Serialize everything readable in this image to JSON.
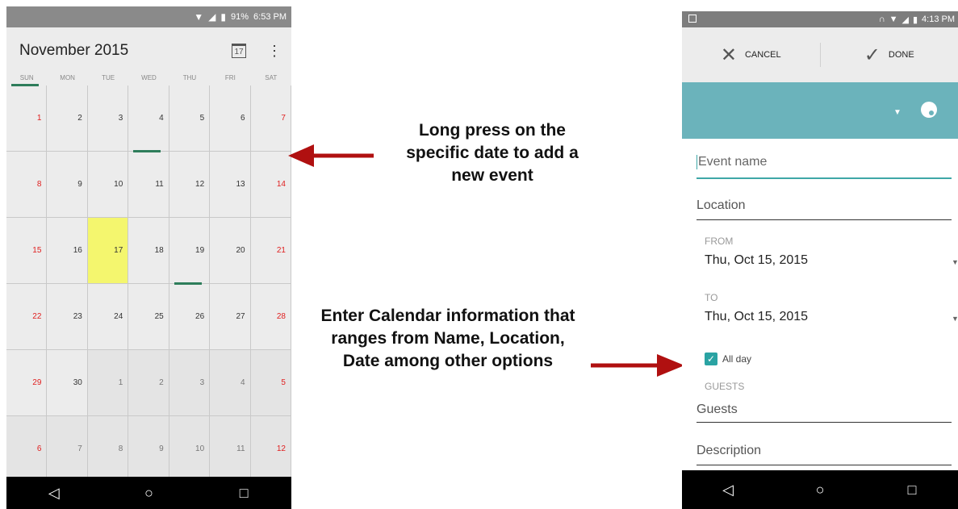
{
  "left_phone": {
    "status": {
      "battery": "91%",
      "time": "6:53 PM"
    },
    "header": {
      "title": "November 2015",
      "today_icon_text": "17",
      "menu_icon": "more-vert"
    },
    "weekdays": [
      "SUN",
      "MON",
      "TUE",
      "WED",
      "THU",
      "FRI",
      "SAT"
    ],
    "weeks": [
      [
        "1",
        "2",
        "3",
        "4",
        "5",
        "6",
        "7"
      ],
      [
        "8",
        "9",
        "10",
        "11",
        "12",
        "13",
        "14"
      ],
      [
        "15",
        "16",
        "17",
        "18",
        "19",
        "20",
        "21"
      ],
      [
        "22",
        "23",
        "24",
        "25",
        "26",
        "27",
        "28"
      ],
      [
        "29",
        "30",
        "1",
        "2",
        "3",
        "4",
        "5"
      ],
      [
        "6",
        "7",
        "8",
        "9",
        "10",
        "11",
        "12"
      ]
    ],
    "today": "17",
    "navbar": {
      "back": "◁",
      "home": "○",
      "recents": "□"
    }
  },
  "right_phone": {
    "status": {
      "time": "4:13 PM"
    },
    "actionbar": {
      "cancel_label": "CANCEL",
      "done_label": "DONE"
    },
    "accent_color": "#6bb3bb",
    "form": {
      "event_name_placeholder": "Event name",
      "location_placeholder": "Location",
      "from_label": "FROM",
      "from_value": "Thu, Oct 15, 2015",
      "to_label": "TO",
      "to_value": "Thu, Oct 15, 2015",
      "allday_label": "All day",
      "allday_checked": true,
      "guests_section": "GUESTS",
      "guests_placeholder": "Guests",
      "description_placeholder": "Description"
    },
    "navbar": {
      "back": "◁",
      "home": "○",
      "recents": "□"
    }
  },
  "annotations": {
    "long_press": "Long press on the specific date to add a new event",
    "enter_info": "Enter Calendar information that ranges from Name, Location, Date among other options"
  }
}
